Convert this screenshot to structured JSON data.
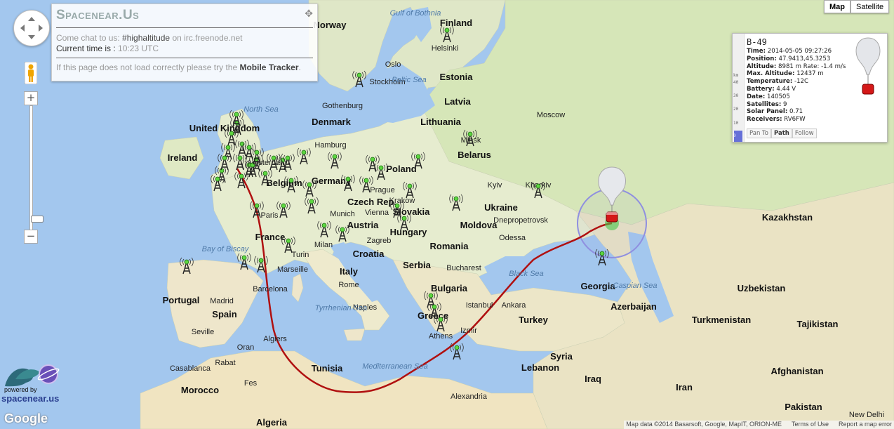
{
  "header": {
    "title": "Spacenear.Us",
    "chat_prefix": "Come chat to us: ",
    "chat_channel": "#highaltitude",
    "chat_suffix": " on irc.freenode.net",
    "time_label": "Current time is : ",
    "time_value": "10:23 UTC",
    "notice_prefix": "If this page does not load correctly please try the ",
    "notice_link": "Mobile Tracker",
    "notice_suffix": "."
  },
  "map_type": {
    "map": "Map",
    "satellite": "Satellite",
    "selected": "Map"
  },
  "popup": {
    "name": "B-49",
    "rows": [
      {
        "label": "Time:",
        "value": "2014-05-05 09:27:26"
      },
      {
        "label": "Position:",
        "value": "47.9413,45.3253"
      },
      {
        "label": "Altitude:",
        "value": "8981 m Rate: -1.4 m/s"
      },
      {
        "label": "Max. Altitude:",
        "value": "12437 m"
      },
      {
        "label": "Temperature:",
        "value": "-12C"
      },
      {
        "label": "Battery:",
        "value": "4.44 V"
      },
      {
        "label": "Date:",
        "value": "140505"
      },
      {
        "label": "Satellites:",
        "value": "9"
      },
      {
        "label": "Solar Panel:",
        "value": "0.71"
      },
      {
        "label": "Receivers:",
        "value": "RV6FW"
      }
    ],
    "buttons": {
      "pan": "Pan To",
      "path": "Path",
      "follow": "Follow"
    },
    "scale_unit": "km",
    "scale_ticks": [
      "40",
      "30",
      "20",
      "10",
      "0"
    ]
  },
  "branding": {
    "powered": "powered by",
    "site": "spacenear.us",
    "google": "Google"
  },
  "attribution": {
    "data": "Map data ©2014 Basarsoft, Google, MapIT, ORION-ME",
    "terms": "Terms of Use",
    "report": "Report a map error"
  },
  "zoom": {
    "in": "+",
    "out": "−",
    "mid": "−"
  },
  "labels": {
    "countries": [
      {
        "t": "Norway"
      },
      {
        "t": "Finland"
      },
      {
        "t": "Estonia"
      },
      {
        "t": "Latvia"
      },
      {
        "t": "Lithuania"
      },
      {
        "t": "Denmark"
      },
      {
        "t": "United Kingdom"
      },
      {
        "t": "Ireland"
      },
      {
        "t": "Belarus"
      },
      {
        "t": "Poland"
      },
      {
        "t": "Germany"
      },
      {
        "t": "Belgium"
      },
      {
        "t": "Ukraine"
      },
      {
        "t": "Kazakhstan"
      },
      {
        "t": "France"
      },
      {
        "t": "Austria"
      },
      {
        "t": "Hungary"
      },
      {
        "t": "Romania"
      },
      {
        "t": "Moldova"
      },
      {
        "t": "Croatia"
      },
      {
        "t": "Serbia"
      },
      {
        "t": "Italy"
      },
      {
        "t": "Bulgaria"
      },
      {
        "t": "Greece"
      },
      {
        "t": "Georgia"
      },
      {
        "t": "Azerbaijan"
      },
      {
        "t": "Uzbekistan"
      },
      {
        "t": "Turkmenistan"
      },
      {
        "t": "Tajikistan"
      },
      {
        "t": "Turkey"
      },
      {
        "t": "Portugal"
      },
      {
        "t": "Spain"
      },
      {
        "t": "Syria"
      },
      {
        "t": "Iraq"
      },
      {
        "t": "Iran"
      },
      {
        "t": "Afghanistan"
      },
      {
        "t": "Pakistan"
      },
      {
        "t": "Morocco"
      },
      {
        "t": "Algeria"
      },
      {
        "t": "Tunisia"
      },
      {
        "t": "Lebanon"
      },
      {
        "t": "Czech Rep."
      },
      {
        "t": "Slovakia"
      }
    ],
    "cities": [
      {
        "t": "Helsinki"
      },
      {
        "t": "Oslo"
      },
      {
        "t": "Stockholm"
      },
      {
        "t": "Gothenburg"
      },
      {
        "t": "Hamburg"
      },
      {
        "t": "Minsk"
      },
      {
        "t": "Kyiv"
      },
      {
        "t": "Kharkiv"
      },
      {
        "t": "Prague"
      },
      {
        "t": "Krakow"
      },
      {
        "t": "Vienna"
      },
      {
        "t": "Munich"
      },
      {
        "t": "Paris"
      },
      {
        "t": "Milan"
      },
      {
        "t": "Turin"
      },
      {
        "t": "Zagreb"
      },
      {
        "t": "Odessa"
      },
      {
        "t": "Dnepropetrovsk"
      },
      {
        "t": "Marseille"
      },
      {
        "t": "Barcelona"
      },
      {
        "t": "Madrid"
      },
      {
        "t": "Seville"
      },
      {
        "t": "Bucharest"
      },
      {
        "t": "Istanbul"
      },
      {
        "t": "Ankara"
      },
      {
        "t": "Izmir"
      },
      {
        "t": "Athens"
      },
      {
        "t": "Rome"
      },
      {
        "t": "Naples"
      },
      {
        "t": "Algiers"
      },
      {
        "t": "Oran"
      },
      {
        "t": "Casablanca"
      },
      {
        "t": "Alexandria"
      },
      {
        "t": "Moscow"
      },
      {
        "t": "Amsterdam"
      },
      {
        "t": "Rabat"
      },
      {
        "t": "Fes"
      },
      {
        "t": "New Delhi"
      }
    ],
    "seas": [
      {
        "t": "North Sea"
      },
      {
        "t": "Baltic Sea"
      },
      {
        "t": "Gulf of Bothnia"
      },
      {
        "t": "Bay of Biscay"
      },
      {
        "t": "Black Sea"
      },
      {
        "t": "Mediterranean Sea"
      },
      {
        "t": "Tyrrhenian Sea"
      },
      {
        "t": "Caspian Sea"
      }
    ]
  }
}
